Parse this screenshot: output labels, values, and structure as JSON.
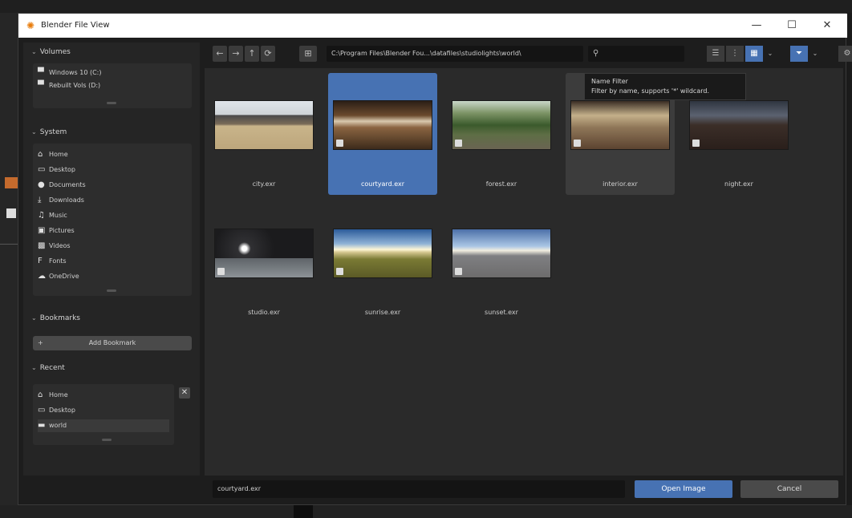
{
  "window": {
    "title": "Blender File View",
    "logo_glyph": "✺",
    "minimize": "—",
    "maximize": "☐",
    "close": "✕"
  },
  "sidebar": {
    "volumes": {
      "header": "Volumes",
      "items": [
        {
          "label": "Windows 10 (C:)",
          "icon": "drive-icon"
        },
        {
          "label": "Rebuilt Vols (D:)",
          "icon": "drive-icon"
        }
      ]
    },
    "system": {
      "header": "System",
      "items": [
        {
          "label": "Home",
          "icon": "home-icon"
        },
        {
          "label": "Desktop",
          "icon": "desktop-icon"
        },
        {
          "label": "Documents",
          "icon": "documents-icon"
        },
        {
          "label": "Downloads",
          "icon": "download-icon"
        },
        {
          "label": "Music",
          "icon": "music-icon"
        },
        {
          "label": "Pictures",
          "icon": "pictures-icon"
        },
        {
          "label": "Videos",
          "icon": "video-icon"
        },
        {
          "label": "Fonts",
          "icon": "font-icon"
        },
        {
          "label": "OneDrive",
          "icon": "cloud-icon"
        }
      ]
    },
    "bookmarks": {
      "header": "Bookmarks",
      "add_label": "Add Bookmark",
      "add_glyph": "+"
    },
    "recent": {
      "header": "Recent",
      "items": [
        {
          "label": "Home",
          "icon": "home-icon"
        },
        {
          "label": "Desktop",
          "icon": "desktop-icon"
        },
        {
          "label": "world",
          "icon": "folder-icon"
        }
      ],
      "clear_glyph": "✕"
    },
    "chevron": "⌄"
  },
  "toolbar": {
    "back": "←",
    "forward": "→",
    "parent": "↑",
    "refresh": "⟳",
    "new_folder": "⊞",
    "path": "C:\\Program Files\\Blender Fou...\\datafiles\\studiolights\\world\\",
    "search_glyph": "⚲",
    "search_placeholder": "",
    "view_vertical": "☰",
    "view_horizontal": "⋮",
    "view_thumbnails": "▦",
    "dropdown": "⌄",
    "filter": "⏷",
    "settings": "⚙"
  },
  "tooltip": {
    "title": "Name Filter",
    "body": "Filter by name, supports '*' wildcard."
  },
  "files": [
    {
      "name": "city.exr",
      "thumb": "t-city"
    },
    {
      "name": "courtyard.exr",
      "thumb": "t-court"
    },
    {
      "name": "forest.exr",
      "thumb": "t-forest"
    },
    {
      "name": "interior.exr",
      "thumb": "t-interior"
    },
    {
      "name": "night.exr",
      "thumb": "t-night"
    },
    {
      "name": "studio.exr",
      "thumb": "t-studio"
    },
    {
      "name": "sunrise.exr",
      "thumb": "t-sunrise"
    },
    {
      "name": "sunset.exr",
      "thumb": "t-sunset"
    }
  ],
  "selected_file": "courtyard.exr",
  "footer": {
    "filename": "courtyard.exr",
    "open_label": "Open Image",
    "cancel_label": "Cancel"
  },
  "colors": {
    "accent": "#4772b3",
    "logo": "#e87d0d"
  }
}
